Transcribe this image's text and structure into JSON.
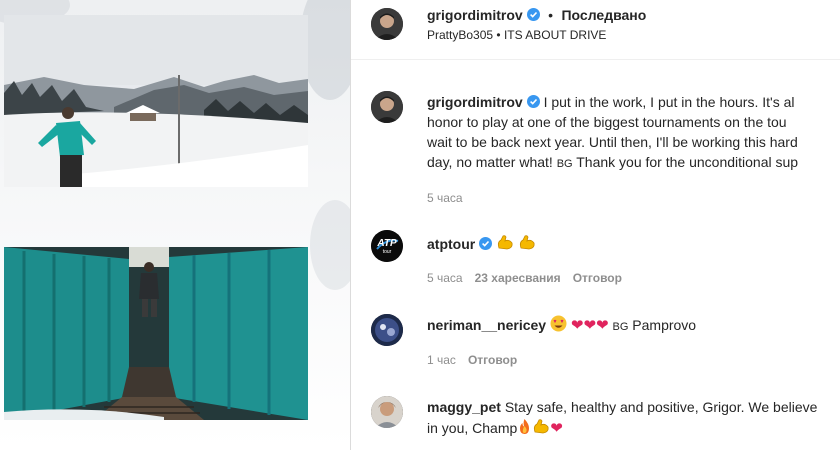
{
  "post": {
    "author": "grigordimitrov",
    "follow_separator": "•",
    "follow_label": "Последвано",
    "audio_artist": "PrattyBo305",
    "audio_separator": "•",
    "audio_title": "ITS ABOUT DRIVE",
    "caption_line1": "I put in the work, I put in the hours. It's al",
    "caption_line2": "honor to play at one of the biggest tournaments on the tou",
    "caption_line3": "wait to be back next year. Until then, I'll be working this hard",
    "caption_line4_a": "day, no matter what! ",
    "caption_line4_flag": "BG",
    "caption_line4_b": " Thank you for the unconditional sup",
    "time": "5 часа"
  },
  "comments": [
    {
      "username": "atptour",
      "verified": true,
      "emojis": [
        "flexed-biceps",
        "flexed-biceps"
      ],
      "time": "5 часа",
      "likes": "23 харесвания",
      "reply": "Отговор"
    },
    {
      "username": "neriman__nericey",
      "text_flag": "BG",
      "text": " Pamprovo",
      "emojis": [
        "heart-eyes",
        "red-heart",
        "red-heart",
        "red-heart"
      ],
      "time": "1 час",
      "reply": "Отговор"
    },
    {
      "username": "maggy_pet",
      "text_line1": "Stay safe, healthy and positive, Grigor. We believe",
      "text_line2": "in you, Champ",
      "emojis": [
        "fire",
        "flexed-biceps",
        "red-heart"
      ]
    }
  ],
  "atp_logo_text": "ATP",
  "atp_logo_sub": "tour",
  "colors": {
    "verified": "#3897f0",
    "muted": "#8e8e8e",
    "text": "#262626",
    "heart": "#e0245e",
    "tunnel_teal": "#1f8a8a"
  }
}
